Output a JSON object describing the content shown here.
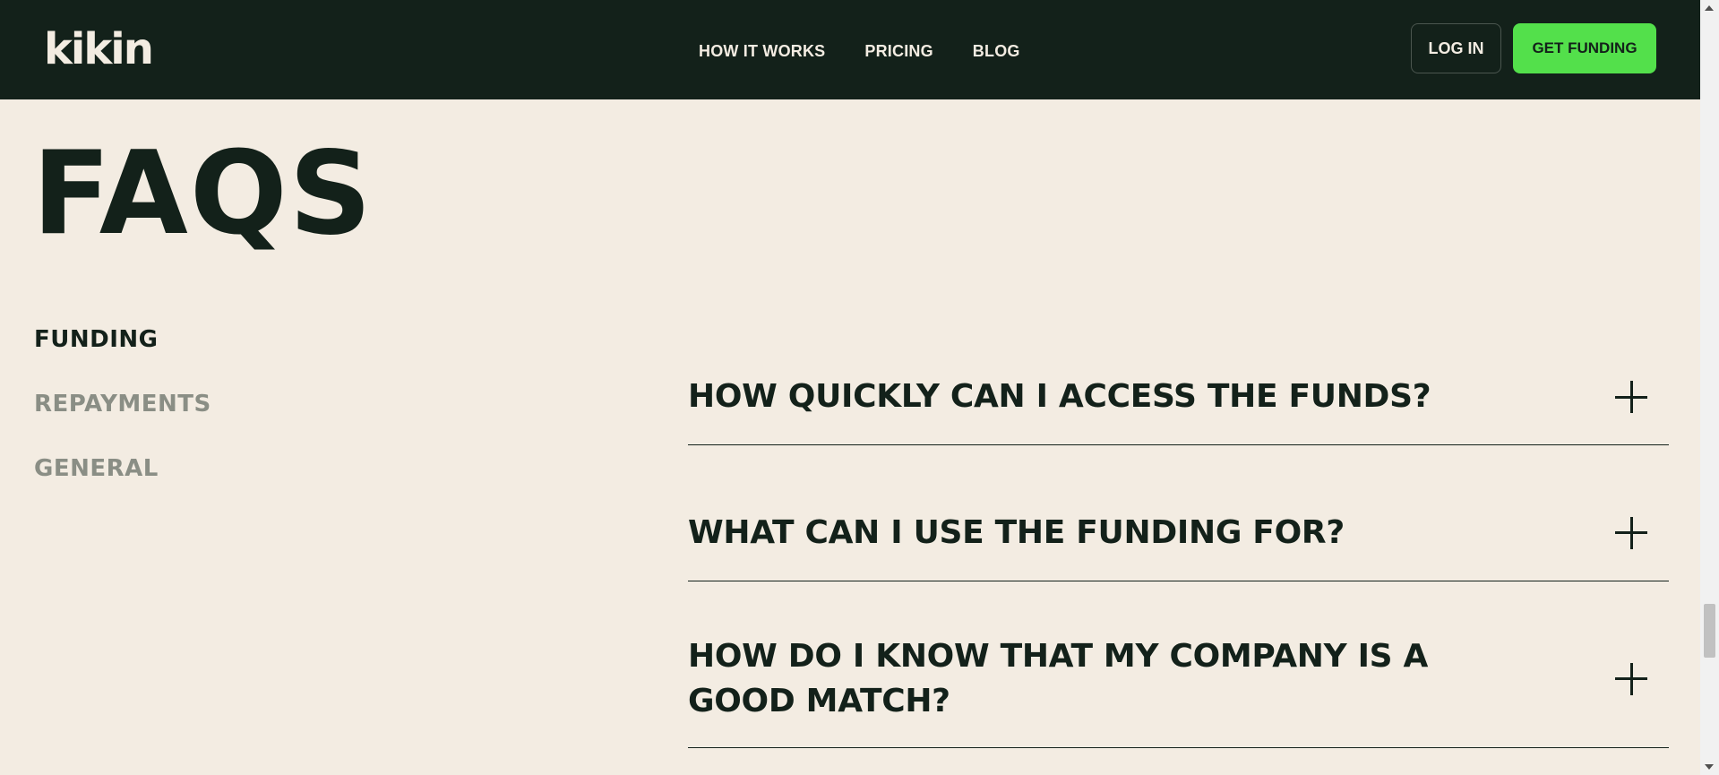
{
  "header": {
    "logo": "kikin",
    "nav": [
      "HOW IT WORKS",
      "PRICING",
      "BLOG"
    ],
    "login_label": "LOG IN",
    "cta_label": "GET FUNDING"
  },
  "faq": {
    "title": "FAQS",
    "categories": [
      "FUNDING",
      "REPAYMENTS",
      "GENERAL"
    ],
    "active_category": "FUNDING",
    "questions": [
      "HOW QUICKLY CAN I ACCESS THE FUNDS?",
      "WHAT CAN I USE THE FUNDING FOR?",
      "HOW DO I KNOW THAT MY COMPANY IS A GOOD MATCH?"
    ]
  },
  "colors": {
    "dark": "#13211a",
    "cream": "#f3ece2",
    "accent": "#53e04b",
    "muted": "#8a8e85"
  }
}
